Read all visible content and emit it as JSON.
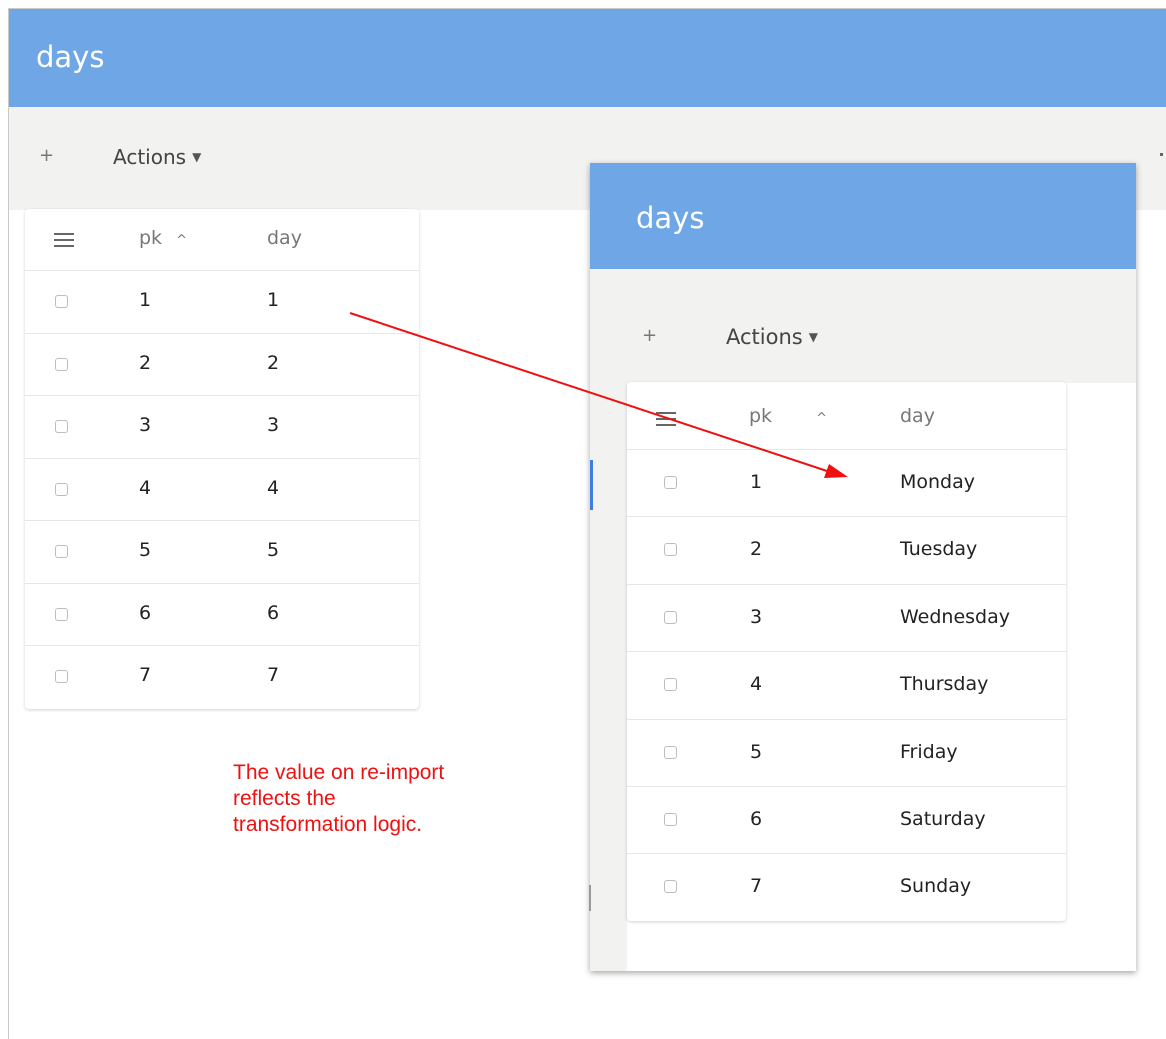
{
  "left_window": {
    "title": "days",
    "toolbar": {
      "add_label": "+",
      "actions_label": "Actions"
    },
    "table": {
      "columns": {
        "pk": "pk",
        "day": "day"
      },
      "rows": [
        {
          "pk": "1",
          "day": "1"
        },
        {
          "pk": "2",
          "day": "2"
        },
        {
          "pk": "3",
          "day": "3"
        },
        {
          "pk": "4",
          "day": "4"
        },
        {
          "pk": "5",
          "day": "5"
        },
        {
          "pk": "6",
          "day": "6"
        },
        {
          "pk": "7",
          "day": "7"
        }
      ]
    }
  },
  "right_window": {
    "title": "days",
    "toolbar": {
      "add_label": "+",
      "actions_label": "Actions"
    },
    "table": {
      "columns": {
        "pk": "pk",
        "day": "day"
      },
      "rows": [
        {
          "pk": "1",
          "day": "Monday"
        },
        {
          "pk": "2",
          "day": "Tuesday"
        },
        {
          "pk": "3",
          "day": "Wednesday"
        },
        {
          "pk": "4",
          "day": "Thursday"
        },
        {
          "pk": "5",
          "day": "Friday"
        },
        {
          "pk": "6",
          "day": "Saturday"
        },
        {
          "pk": "7",
          "day": "Sunday"
        }
      ]
    }
  },
  "annotation": {
    "line1": "The value on re-import",
    "line2": "reflects the",
    "line3": "transformation logic.",
    "color": "#ee1111"
  },
  "icons": {
    "menu": "hamburger-menu-icon",
    "sort": "sort-ascending-icon",
    "dropdown": "caret-down-icon",
    "add": "plus-icon"
  },
  "colors": {
    "appbar": "#6fa6e6",
    "toolbar": "#f2f2f1",
    "arrow": "#ee1111"
  }
}
